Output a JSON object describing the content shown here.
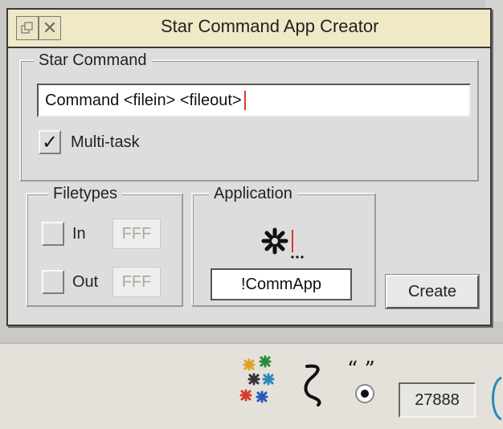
{
  "window": {
    "title": "Star Command App Creator"
  },
  "star_command": {
    "group_label": "Star Command",
    "command_value": "Command <filein> <fileout>",
    "multitask_label": "Multi-task",
    "multitask_checked": true,
    "check_glyph": "✓"
  },
  "filetypes": {
    "group_label": "Filetypes",
    "in_label": "In",
    "in_value": "FFF",
    "out_label": "Out",
    "out_value": "FFF"
  },
  "application": {
    "group_label": "Application",
    "sprite_icon": "star-sprite-icon",
    "name_value": "!CommApp"
  },
  "create_button": {
    "label": "Create"
  },
  "iconbar": {
    "icons": [
      "colour-stars-icon",
      "squiggle-icon",
      "quotes-icon"
    ],
    "clock_value": "27888"
  }
}
